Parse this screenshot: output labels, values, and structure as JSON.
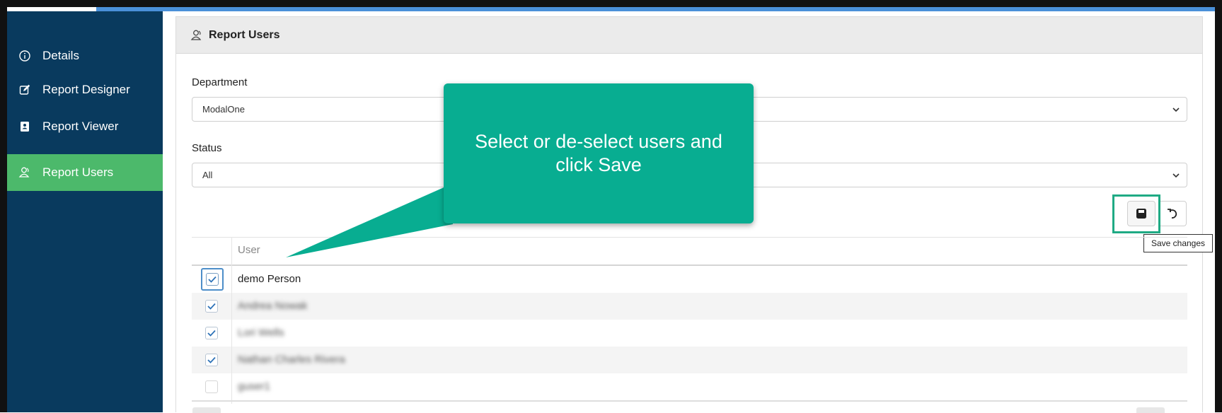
{
  "sidebar": {
    "items": [
      {
        "label": "Details",
        "icon": "info-icon"
      },
      {
        "label": "Report Designer",
        "icon": "edit-icon"
      },
      {
        "label": "Report Viewer",
        "icon": "contact-book-icon"
      },
      {
        "label": "Report Users",
        "icon": "users-icon",
        "active": true
      }
    ]
  },
  "panel": {
    "title": "Report Users",
    "department": {
      "label": "Department",
      "value": "ModalOne"
    },
    "status": {
      "label": "Status",
      "value": "All"
    },
    "toolbar": {
      "save_tooltip": "Save changes"
    }
  },
  "table": {
    "column_header": "User",
    "rows": [
      {
        "name": "demo Person",
        "checked": true
      },
      {
        "name": "Andrea Nowak",
        "checked": true,
        "blurred": true
      },
      {
        "name": "Lori Wells",
        "checked": true,
        "blurred": true
      },
      {
        "name": "Nathan Charles Rivera",
        "checked": true,
        "blurred": true
      },
      {
        "name": "guser1",
        "checked": false,
        "blurred": true
      }
    ]
  },
  "callout": {
    "text": "Select or de-select users and click Save"
  },
  "colors": {
    "sidebar": "#093a5e",
    "active": "#4cb96b",
    "callout": "#08ad91",
    "accent": "#4a90d9"
  }
}
